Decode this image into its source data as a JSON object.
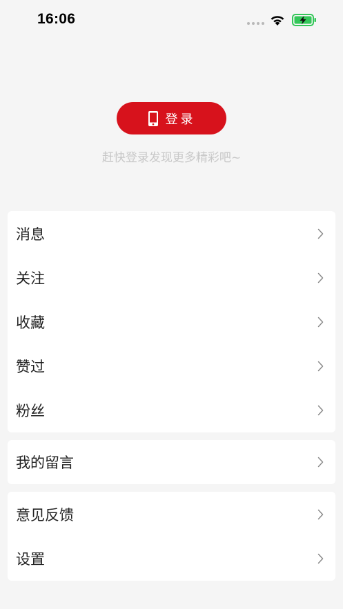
{
  "status_bar": {
    "time": "16:06",
    "wifi_icon": "wifi-icon",
    "battery_icon": "battery-charging-icon",
    "battery_color": "#34c759"
  },
  "login": {
    "button_label": "登录",
    "button_icon": "phone-icon",
    "hint": "赶快登录发现更多精彩吧~",
    "accent_color": "#d7121c"
  },
  "menu": {
    "group_1": [
      {
        "label": "消息"
      },
      {
        "label": "关注"
      },
      {
        "label": "收藏"
      },
      {
        "label": "赞过"
      },
      {
        "label": "粉丝"
      }
    ],
    "group_2": [
      {
        "label": "我的留言"
      }
    ],
    "group_3": [
      {
        "label": "意见反馈"
      },
      {
        "label": "设置"
      }
    ],
    "row_icon": "chevron-right-icon"
  }
}
